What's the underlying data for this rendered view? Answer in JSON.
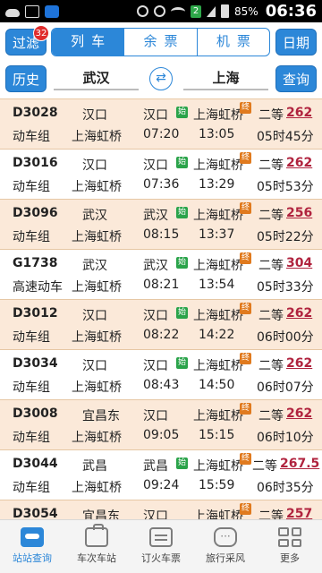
{
  "status_bar": {
    "battery": "85%",
    "time": "06:36",
    "sim_indicator": "2"
  },
  "toolbar": {
    "filter_label": "过滤",
    "filter_badge": "32",
    "tabs": [
      {
        "label": "列车",
        "active": true
      },
      {
        "label": "余票",
        "active": false
      },
      {
        "label": "机票",
        "active": false
      }
    ],
    "date_label": "日期"
  },
  "route": {
    "history_label": "历史",
    "from_station": "武汉",
    "swap_icon": "swap-icon",
    "to_station": "上海",
    "query_label": "查询"
  },
  "colors": {
    "accent": "#2c87d8",
    "row_alt": "#fbe9d9",
    "price": "#b0233e",
    "start_tag": "#2aa34a",
    "end_tag": "#e07a1e",
    "badge": "#e02c2c"
  },
  "trains": [
    {
      "code": "D3028",
      "type": "动车组",
      "from": "汉口",
      "to": "上海虹桥",
      "dep_station": "汉口",
      "dep_time": "07:20",
      "arr_station": "上海虹桥",
      "arr_time": "13:05",
      "seat": "二等",
      "price": "262",
      "duration": "05时45分",
      "start_tag": "始",
      "end_tag": "终"
    },
    {
      "code": "D3016",
      "type": "动车组",
      "from": "汉口",
      "to": "上海虹桥",
      "dep_station": "汉口",
      "dep_time": "07:36",
      "arr_station": "上海虹桥",
      "arr_time": "13:29",
      "seat": "二等",
      "price": "262",
      "duration": "05时53分",
      "start_tag": "始",
      "end_tag": "终"
    },
    {
      "code": "D3096",
      "type": "动车组",
      "from": "武汉",
      "to": "上海虹桥",
      "dep_station": "武汉",
      "dep_time": "08:15",
      "arr_station": "上海虹桥",
      "arr_time": "13:37",
      "seat": "二等",
      "price": "256",
      "duration": "05时22分",
      "start_tag": "始",
      "end_tag": "终"
    },
    {
      "code": "G1738",
      "type": "高速动车",
      "from": "武汉",
      "to": "上海虹桥",
      "dep_station": "武汉",
      "dep_time": "08:21",
      "arr_station": "上海虹桥",
      "arr_time": "13:54",
      "seat": "二等",
      "price": "304",
      "duration": "05时33分",
      "start_tag": "始",
      "end_tag": "终"
    },
    {
      "code": "D3012",
      "type": "动车组",
      "from": "汉口",
      "to": "上海虹桥",
      "dep_station": "汉口",
      "dep_time": "08:22",
      "arr_station": "上海虹桥",
      "arr_time": "14:22",
      "seat": "二等",
      "price": "262",
      "duration": "06时00分",
      "start_tag": "始",
      "end_tag": "终"
    },
    {
      "code": "D3034",
      "type": "动车组",
      "from": "汉口",
      "to": "上海虹桥",
      "dep_station": "汉口",
      "dep_time": "08:43",
      "arr_station": "上海虹桥",
      "arr_time": "14:50",
      "seat": "二等",
      "price": "262",
      "duration": "06时07分",
      "start_tag": "始",
      "end_tag": "终"
    },
    {
      "code": "D3008",
      "type": "动车组",
      "from": "宜昌东",
      "to": "上海虹桥",
      "dep_station": "汉口",
      "dep_time": "09:05",
      "arr_station": "上海虹桥",
      "arr_time": "15:15",
      "seat": "二等",
      "price": "262",
      "duration": "06时10分",
      "start_tag": "",
      "end_tag": "终"
    },
    {
      "code": "D3044",
      "type": "动车组",
      "from": "武昌",
      "to": "上海虹桥",
      "dep_station": "武昌",
      "dep_time": "09:24",
      "arr_station": "上海虹桥",
      "arr_time": "15:59",
      "seat": "二等",
      "price": "267.5",
      "duration": "06时35分",
      "start_tag": "始",
      "end_tag": "终"
    },
    {
      "code": "D3054",
      "type": "",
      "from": "宜昌东",
      "to": "",
      "dep_station": "汉口",
      "dep_time": "",
      "arr_station": "上海虹桥",
      "arr_time": "",
      "seat": "二等",
      "price": "257",
      "duration": "",
      "start_tag": "",
      "end_tag": "终"
    }
  ],
  "bottom_nav": [
    {
      "label": "站站查询",
      "icon": "train-icon",
      "active": true
    },
    {
      "label": "车次车站",
      "icon": "briefcase-icon",
      "active": false
    },
    {
      "label": "订火车票",
      "icon": "ticket-icon",
      "active": false
    },
    {
      "label": "旅行采风",
      "icon": "chat-bubble-icon",
      "active": false
    },
    {
      "label": "更多",
      "icon": "grid-icon",
      "active": false
    }
  ]
}
